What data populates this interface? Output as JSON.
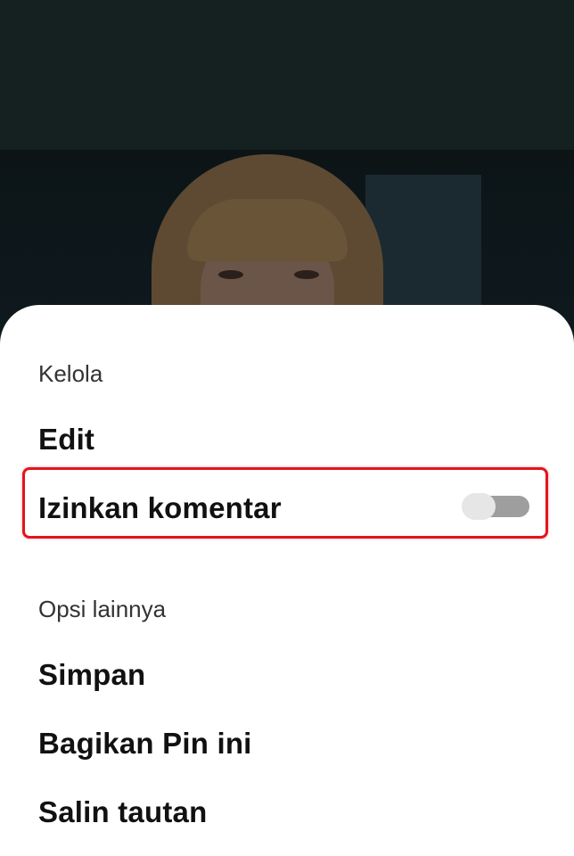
{
  "sheet": {
    "manage_section": {
      "heading": "Kelola",
      "items": [
        {
          "label": "Edit"
        },
        {
          "label": "Izinkan komentar",
          "toggle_on": false
        }
      ]
    },
    "other_section": {
      "heading": "Opsi lainnya",
      "items": [
        {
          "label": "Simpan"
        },
        {
          "label": "Bagikan Pin ini"
        },
        {
          "label": "Salin tautan"
        }
      ]
    }
  },
  "colors": {
    "highlight_border": "#e3141c",
    "toggle_track": "#9e9e9e",
    "toggle_knob": "#e6e6e6",
    "sheet_background": "#ffffff"
  }
}
